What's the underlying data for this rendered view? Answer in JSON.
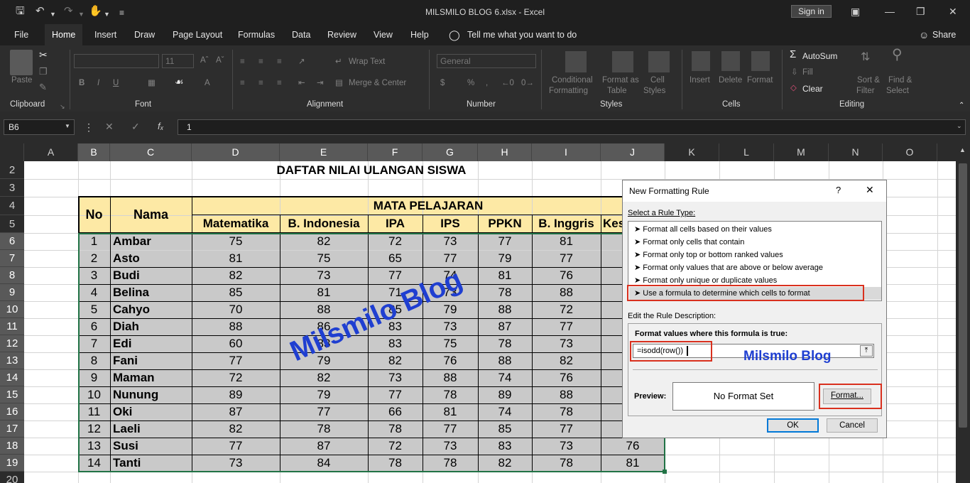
{
  "titlebar": {
    "title": "MILSMILO BLOG 6.xlsx  -  Excel",
    "signin": "Sign in"
  },
  "tabs": [
    "File",
    "Home",
    "Insert",
    "Draw",
    "Page Layout",
    "Formulas",
    "Data",
    "Review",
    "View",
    "Help"
  ],
  "tellme": "Tell me what you want to do",
  "share": "Share",
  "ribbon": {
    "paste": "Paste",
    "font": "Font",
    "clipboard": "Clipboard",
    "alignment": "Alignment",
    "number": "Number",
    "styles": "Styles",
    "cells": "Cells",
    "editing": "Editing",
    "font_size": "11",
    "wrap": "Wrap Text",
    "merge": "Merge & Center",
    "numfmt": "General",
    "cond": "Conditional",
    "cond2": "Formatting",
    "fmtas": "Format as",
    "fmtas2": "Table",
    "cellst": "Cell",
    "cellst2": "Styles",
    "insert": "Insert",
    "delete": "Delete",
    "format": "Format",
    "autosum": "AutoSum",
    "fill": "Fill",
    "clear": "Clear",
    "sort": "Sort &",
    "sort2": "Filter",
    "find": "Find &",
    "find2": "Select"
  },
  "formula_bar": {
    "name_box": "B6",
    "formula": "1"
  },
  "columns": [
    "A",
    "B",
    "C",
    "D",
    "E",
    "F",
    "G",
    "H",
    "I",
    "J",
    "K",
    "L",
    "M",
    "N",
    "O"
  ],
  "rows": [
    "2",
    "3",
    "4",
    "5",
    "6",
    "7",
    "8",
    "9",
    "10",
    "11",
    "12",
    "13",
    "14",
    "15",
    "16",
    "17",
    "18",
    "19",
    "20"
  ],
  "sheet": {
    "title": "DAFTAR NILAI ULANGAN SISWA",
    "h_no": "No",
    "h_nama": "Nama",
    "h_mapel": "MATA PELAJARAN",
    "subjects": [
      "Matematika",
      "B. Indonesia",
      "IPA",
      "IPS",
      "PPKN",
      "B. Inggris",
      "Kes"
    ],
    "students": [
      {
        "no": "1",
        "nama": "Ambar",
        "v": [
          "75",
          "82",
          "72",
          "73",
          "77",
          "81",
          ""
        ]
      },
      {
        "no": "2",
        "nama": "Asto",
        "v": [
          "81",
          "75",
          "65",
          "77",
          "79",
          "77",
          ""
        ]
      },
      {
        "no": "3",
        "nama": "Budi",
        "v": [
          "82",
          "73",
          "77",
          "74",
          "81",
          "76",
          ""
        ]
      },
      {
        "no": "4",
        "nama": "Belina",
        "v": [
          "85",
          "81",
          "71",
          "73",
          "78",
          "88",
          ""
        ]
      },
      {
        "no": "5",
        "nama": "Cahyo",
        "v": [
          "70",
          "88",
          "85",
          "79",
          "88",
          "72",
          ""
        ]
      },
      {
        "no": "6",
        "nama": "Diah",
        "v": [
          "88",
          "86",
          "83",
          "73",
          "87",
          "77",
          ""
        ]
      },
      {
        "no": "7",
        "nama": "Edi",
        "v": [
          "60",
          "83",
          "83",
          "75",
          "78",
          "73",
          ""
        ]
      },
      {
        "no": "8",
        "nama": "Fani",
        "v": [
          "77",
          "79",
          "82",
          "76",
          "88",
          "82",
          ""
        ]
      },
      {
        "no": "9",
        "nama": "Maman",
        "v": [
          "72",
          "82",
          "73",
          "88",
          "74",
          "76",
          ""
        ]
      },
      {
        "no": "10",
        "nama": "Nunung",
        "v": [
          "89",
          "79",
          "77",
          "78",
          "89",
          "88",
          ""
        ]
      },
      {
        "no": "11",
        "nama": "Oki",
        "v": [
          "87",
          "77",
          "66",
          "81",
          "74",
          "78",
          ""
        ]
      },
      {
        "no": "12",
        "nama": "Laeli",
        "v": [
          "82",
          "78",
          "78",
          "77",
          "85",
          "77",
          ""
        ]
      },
      {
        "no": "13",
        "nama": "Susi",
        "v": [
          "77",
          "87",
          "72",
          "73",
          "83",
          "73",
          "76"
        ]
      },
      {
        "no": "14",
        "nama": "Tanti",
        "v": [
          "73",
          "84",
          "78",
          "78",
          "82",
          "78",
          "81"
        ]
      }
    ]
  },
  "dialog": {
    "title": "New Formatting Rule",
    "help": "?",
    "close": "✕",
    "select_label": "Select a Rule Type:",
    "rule_types": [
      "Format all cells based on their values",
      "Format only cells that contain",
      "Format only top or bottom ranked values",
      "Format only values that are above or below average",
      "Format only unique or duplicate values",
      "Use a formula to determine which cells to format"
    ],
    "edit_label": "Edit the Rule Description:",
    "formula_label": "Format values where this formula is true:",
    "formula": "=isodd(row())",
    "preview_label": "Preview:",
    "preview_text": "No Format Set",
    "format_btn": "Format...",
    "ok": "OK",
    "cancel": "Cancel"
  },
  "watermarks": [
    "Milsmilo Blog",
    "Milsmilo Blog"
  ]
}
